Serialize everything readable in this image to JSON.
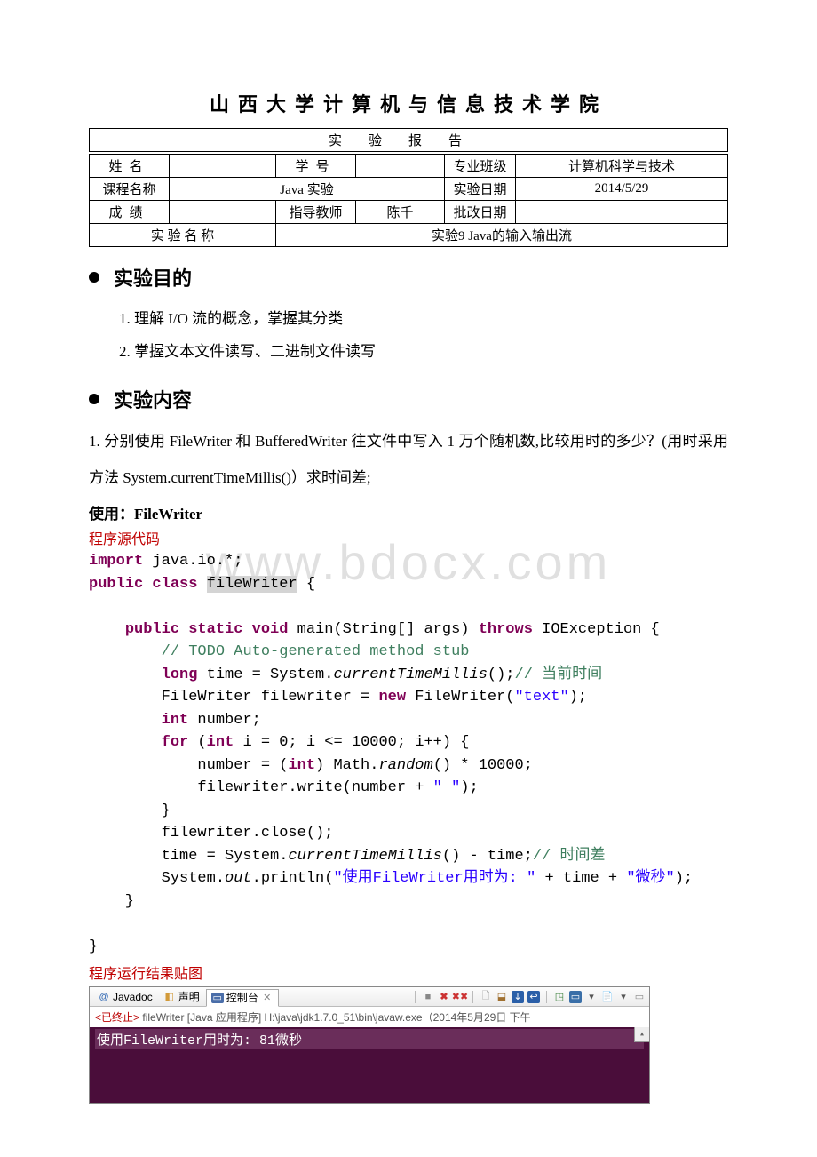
{
  "page_title": "山西大学计算机与信息技术学院",
  "subtitle": "实验报告",
  "header": {
    "labels": {
      "name": "姓名",
      "student_id": "学号",
      "major_class": "专业班级",
      "major_value": "计算机科学与技术",
      "course": "课程名称",
      "course_value": "Java 实验",
      "exp_date": "实验日期",
      "exp_date_value": "2014/5/29",
      "grade": "成绩",
      "teacher": "指导教师",
      "teacher_value": "陈千",
      "correct_date": "批改日期",
      "exp_name": "实 验 名 称",
      "exp_name_value": "实验9   Java的输入输出流"
    }
  },
  "sections": {
    "objective_title": "实验目的",
    "objectives": [
      "1.  理解 I/O 流的概念，掌握其分类",
      "2.  掌握文本文件读写、二进制文件读写"
    ],
    "content_title": "实验内容",
    "task1_desc": "1.  分别使用 FileWriter  和  BufferedWriter  往文件中写入 1 万个随机数,比较用时的多少？(用时采用方法 System.currentTimeMillis()）求时间差;",
    "use_filewriter": "使用：FileWriter",
    "src_label": "程序源代码",
    "result_label": "程序运行结果贴图"
  },
  "code": {
    "l1_import": "import",
    "l1_pkg": " java.io.*;",
    "l2_pub": "public class ",
    "l2_cls": "fileWriter",
    "l2_after": " {",
    "l4_sig_pre": "    ",
    "l4_kw1": "public static void",
    "l4_mid": " main(String[] args) ",
    "l4_kw2": "throws",
    "l4_after": " IOException {",
    "l5_pre": "        ",
    "l5_cmt": "// TODO Auto-generated method stub",
    "l6_pre": "        ",
    "l6_kw": "long",
    "l6_mid": " time = System.",
    "l6_it": "currentTimeMillis",
    "l6_after": "();",
    "l6_cmt": "// 当前时间",
    "l7_pre": "        FileWriter filewriter = ",
    "l7_kw": "new",
    "l7_mid": " FileWriter(",
    "l7_str": "\"text\"",
    "l7_after": ");",
    "l8_pre": "        ",
    "l8_kw": "int",
    "l8_after": " number;",
    "l9_pre": "        ",
    "l9_kw1": "for",
    "l9_mid1": " (",
    "l9_kw2": "int",
    "l9_after": " i = 0; i <= 10000; i++) {",
    "l10": "            number = (",
    "l10_kw": "int",
    "l10_mid": ") Math.",
    "l10_it": "random",
    "l10_after": "() * 10000;",
    "l11_pre": "            filewriter.write(number + ",
    "l11_str": "\" \"",
    "l11_after": ");",
    "l12": "        }",
    "l13": "        filewriter.close();",
    "l14_pre": "        time = System.",
    "l14_it": "currentTimeMillis",
    "l14_mid": "() - time;",
    "l14_cmt": "// 时间差",
    "l15_pre": "        System.",
    "l15_it": "out",
    "l15_mid": ".println(",
    "l15_str1": "\"使用FileWriter用时为: \"",
    "l15_plus1": " + time + ",
    "l15_str2": "\"微秒\"",
    "l15_after": ");",
    "l16": "    }",
    "l18": "}"
  },
  "console": {
    "tab_javadoc": "Javadoc",
    "tab_decl": "声明",
    "tab_console": "控制台",
    "info_prefix": "<已终止> ",
    "info_body": "fileWriter [Java 应用程序] H:\\java\\jdk1.7.0_51\\bin\\javaw.exe（2014年5月29日 下午",
    "output": "使用FileWriter用时为: 81微秒"
  },
  "watermark": "www.bdocx.com"
}
